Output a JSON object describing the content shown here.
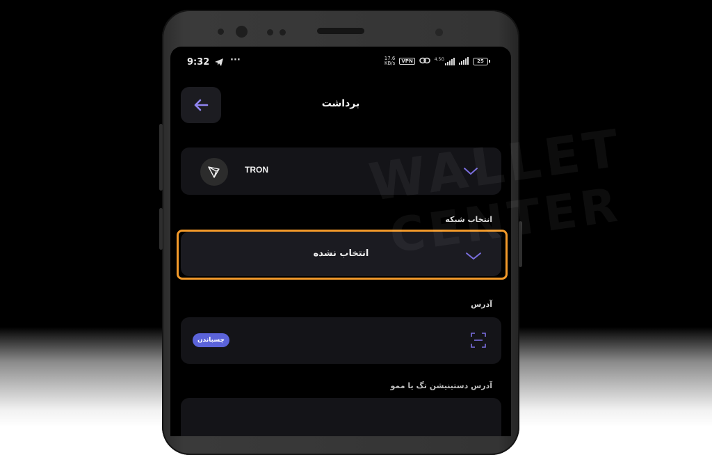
{
  "status_bar": {
    "time": "9:32",
    "net_speed_value": "17.6",
    "net_speed_unit": "KB/s",
    "vpn": "VPN",
    "lte": "4.5G",
    "battery": "25"
  },
  "header": {
    "title": "برداشت",
    "back_icon": "arrow-left-icon"
  },
  "token": {
    "name": "TRON",
    "icon": "tron-icon"
  },
  "network": {
    "label": "انتخاب شبکه",
    "value": "انتخاب نشده"
  },
  "address": {
    "label": "آدرس",
    "paste_label": "چسباندن",
    "scan_icon": "qr-scan-icon"
  },
  "memo": {
    "label": "آدرس دستینیشن تگ یا ممو"
  },
  "watermark": {
    "line1": "WALLET",
    "line2": "CENTER"
  },
  "colors": {
    "accent": "#7b6fe0",
    "highlight": "#f39a2a",
    "paste_button": "#5b63d9"
  }
}
